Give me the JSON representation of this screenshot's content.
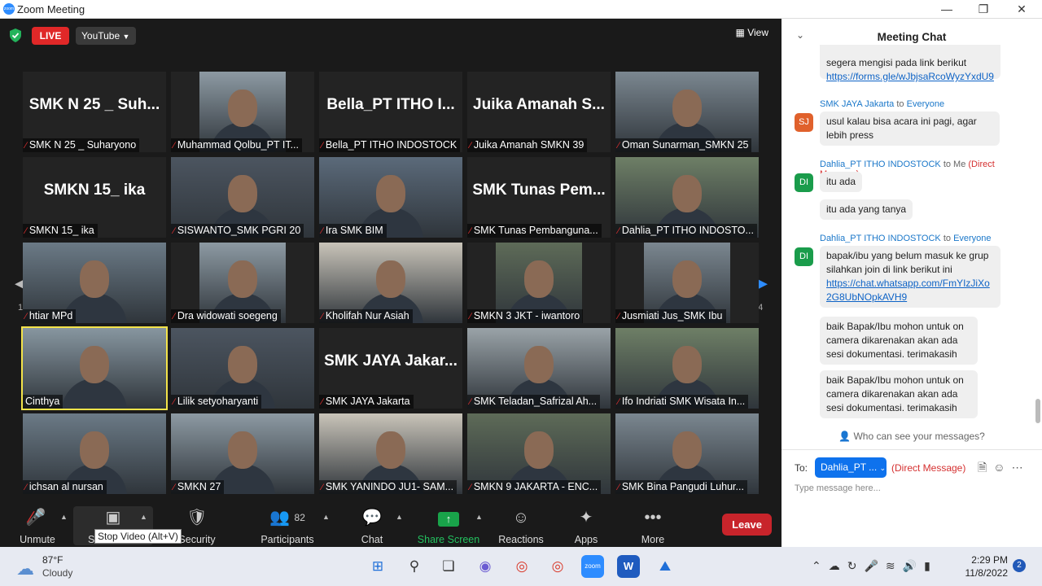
{
  "window": {
    "title": "Zoom Meeting",
    "logo_text": "zoom"
  },
  "topbar": {
    "live": "LIVE",
    "youtube": "YouTube",
    "view": "View"
  },
  "pagination": {
    "left": "1/4",
    "right": "1/4"
  },
  "tiles": [
    {
      "name": "SMK N 25 _ Suharyono",
      "big": "SMK N 25 _ Suh..."
    },
    {
      "name": "Muhammad Qolbu_PT IT..."
    },
    {
      "name": "Bella_PT ITHO INDOSTOCK",
      "big": "Bella_PT ITHO I..."
    },
    {
      "name": "Juika Amanah SMKN 39",
      "big": "Juika Amanah S..."
    },
    {
      "name": "Oman Sunarman_SMKN 25"
    },
    {
      "name": "SMKN 15_ ika",
      "big": "SMKN 15_ ika"
    },
    {
      "name": "SISWANTO_SMK PGRI 20"
    },
    {
      "name": "Ira SMK BIM"
    },
    {
      "name": "SMK Tunas Pembanguna...",
      "big": "SMK Tunas Pem..."
    },
    {
      "name": "Dahlia_PT ITHO INDOSTO..."
    },
    {
      "name": "htiar MPd"
    },
    {
      "name": "Dra widowati soegeng"
    },
    {
      "name": "Kholifah Nur Asiah"
    },
    {
      "name": "SMKN 3 JKT - iwantoro"
    },
    {
      "name": "Jusmiati Jus_SMK Ibu"
    },
    {
      "name": "Cinthya"
    },
    {
      "name": "Lilik setyoharyanti"
    },
    {
      "name": "SMK JAYA Jakarta",
      "big": "SMK JAYA Jakar..."
    },
    {
      "name": "SMK Teladan_Safrizal Ah..."
    },
    {
      "name": "Ifo Indriati SMK Wisata In..."
    },
    {
      "name": "ichsan al nursan"
    },
    {
      "name": "SMKN 27"
    },
    {
      "name": "SMK YANINDO JU1- SAM..."
    },
    {
      "name": "SMKN 9 JAKARTA  - ENC..."
    },
    {
      "name": "SMK Bina Pangudi Luhur..."
    }
  ],
  "toolbar": {
    "unmute": "Unmute",
    "stop_video_short": "S",
    "security": "Security",
    "participants": "Participants",
    "participants_count": "82",
    "chat": "Chat",
    "share_screen": "Share Screen",
    "reactions": "Reactions",
    "apps": "Apps",
    "more": "More",
    "leave": "Leave",
    "tooltip": "Stop Video (Alt+V)"
  },
  "chat": {
    "header": "Meeting Chat",
    "m0_text": "segera mengisi pada link berikut",
    "m0_link": "https://forms.gle/wJbjsaRcoWyzYxdU9",
    "s1_sender": "SMK JAYA Jakarta",
    "s1_to": "to",
    "s1_target": "Everyone",
    "s1_avatar": "SJ",
    "s1_m1": "usul kalau bisa acara ini pagi, agar lebih press",
    "s2_sender": "Dahlia_PT ITHO INDOSTOCK",
    "s2_to": "to Me",
    "s2_dm": "(Direct Message)",
    "s2_avatar": "DI",
    "s2_m1": "itu ada",
    "s2_m2": "itu ada yang tanya",
    "s3_sender": "Dahlia_PT ITHO INDOSTOCK",
    "s3_to": "to",
    "s3_target": "Everyone",
    "s3_avatar": "DI",
    "s3_m1": "bapak/ibu yang belum masuk ke grup silahkan join di link berikut ini",
    "s3_link": "https://chat.whatsapp.com/FmYIzJiXo2G8UbNOpkAVH9",
    "s3_m2": "baik Bapak/Ibu mohon untuk on camera dikarenakan akan ada sesi dokumentasi. terimakasih",
    "s3_m3": "baik Bapak/Ibu mohon untuk on camera dikarenakan akan ada sesi dokumentasi. terimakasih",
    "who_can_see": "Who can see your messages?",
    "to_label": "To:",
    "to_value": "Dahlia_PT ...",
    "to_dm": "(Direct Message)",
    "placeholder": "Type message here..."
  },
  "taskbar": {
    "temp": "87°F",
    "condition": "Cloudy",
    "time": "2:29 PM",
    "date": "11/8/2022",
    "notifications": "2"
  },
  "colors": {
    "live": "#e02828",
    "accent": "#2d8cff",
    "leave": "#c8242b",
    "share": "#19a34a",
    "highlight": "#f3e34a"
  }
}
